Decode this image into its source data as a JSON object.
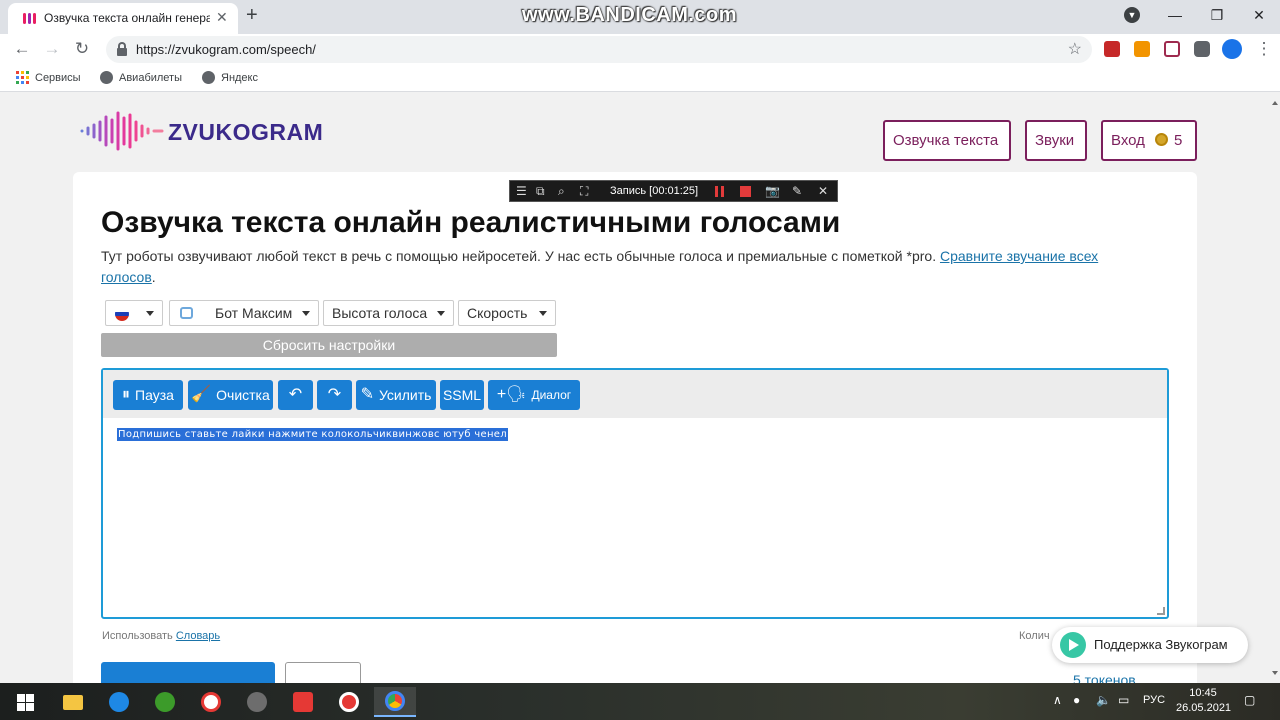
{
  "browser": {
    "tab_title": "Озвучка текста онлайн генерат",
    "url": "https://zvukogram.com/speech/",
    "watermark": "www.BANDICAM.com",
    "bookmarks": [
      "Сервисы",
      "Авиабилеты",
      "Яндекс"
    ]
  },
  "site": {
    "logo_text": "ZVUKOGRAM",
    "nav": {
      "tts": "Озвучка текста",
      "sounds": "Звуки",
      "login": "Вход",
      "coins": "5"
    },
    "heading": "Озвучка текста онлайн реалистичными голосами",
    "description": "Тут роботы озвучивают любой текст в речь с помощью нейросетей. У нас есть обычные голоса и премиальные с пометкой *pro. ",
    "description_link": "Сравните звучание всех голосов",
    "description_end": ".",
    "controls": {
      "voice": "Бот Максим",
      "pitch": "Высота голоса",
      "speed": "Скорость",
      "reset": "Сбросить настройки"
    },
    "editor": {
      "pause": "Пауза",
      "clear": "Очистка",
      "boost": "Усилить",
      "ssml": "SSML",
      "dialog": "Диалог",
      "text": "Подпишись ставьте лайки нажмите колокольчиквинжовс ютуб ченел"
    },
    "dict_prefix": "Использовать ",
    "dict_link": "Словарь",
    "count_label": "Колич",
    "tokens": "5  токенов",
    "support": "Поддержка Звукограм"
  },
  "recorder": {
    "status": "Запись [00:01:25]"
  },
  "taskbar": {
    "lang": "РУС",
    "time": "10:45",
    "date": "26.05.2021"
  },
  "colors": {
    "accent_blue": "#1a7fd4",
    "nav_border": "#7b1f5c",
    "editor_border": "#1e9bd7"
  }
}
